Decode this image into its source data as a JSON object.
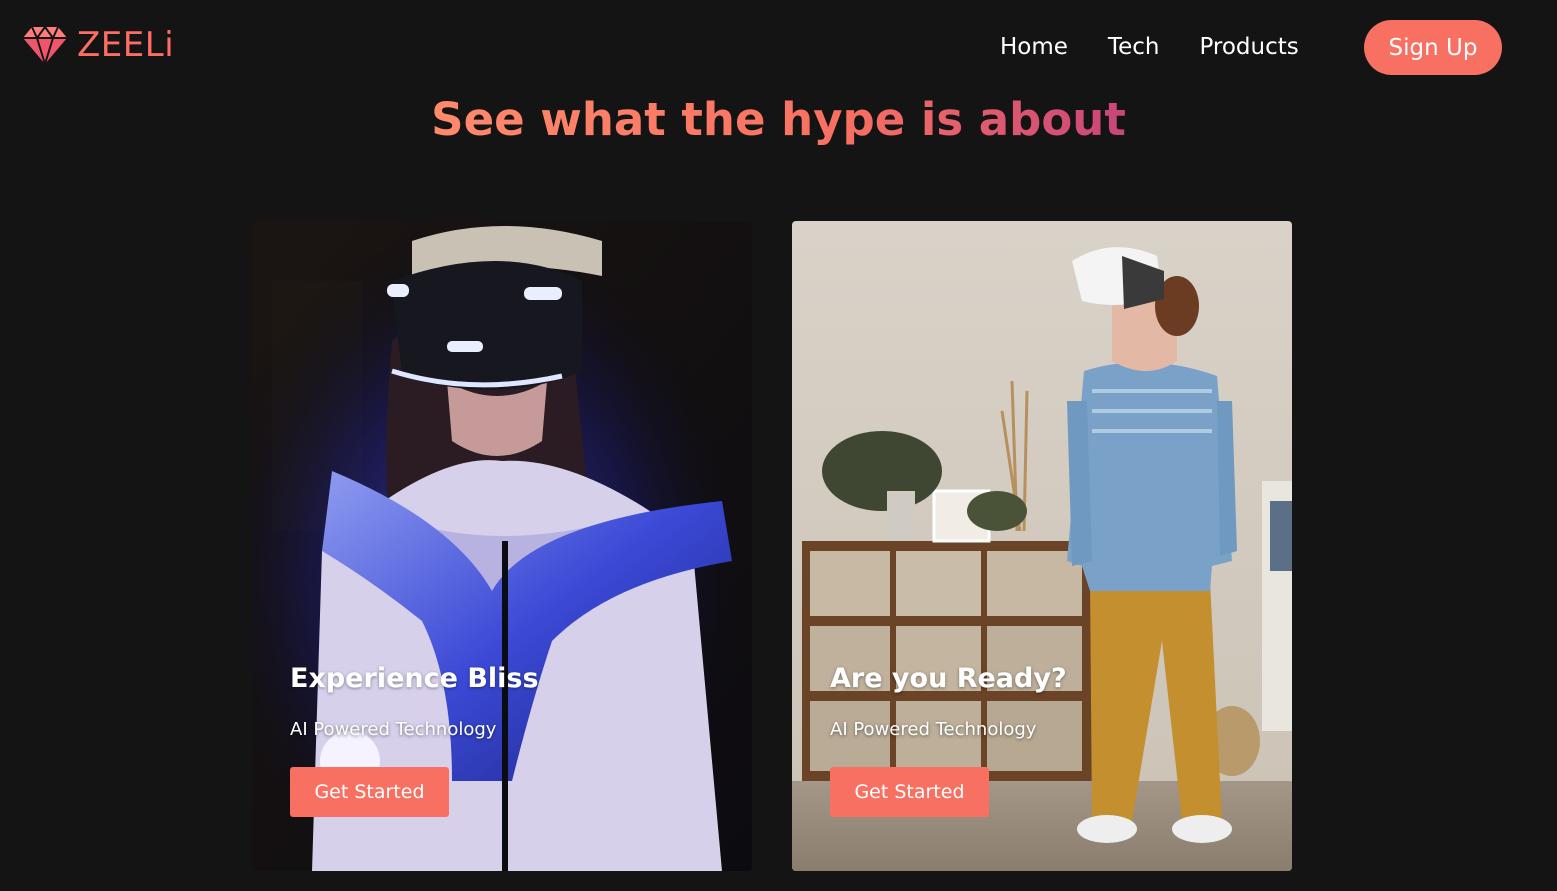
{
  "brand": {
    "name": "ZEELi",
    "logo_icon": "diamond-icon",
    "color": "#fc6d63"
  },
  "nav": {
    "links": [
      "Home",
      "Tech",
      "Products"
    ],
    "signup_label": "Sign Up"
  },
  "hero": {
    "title": "See what the hype is about"
  },
  "cards": [
    {
      "title": "Experience Bliss",
      "subtitle": "AI Powered Technology",
      "button_label": "Get Started",
      "image": "woman-vr-headset-photo"
    },
    {
      "title": "Are you Ready?",
      "subtitle": "AI Powered Technology",
      "button_label": "Get Started",
      "image": "boy-vr-headset-photo"
    }
  ],
  "colors": {
    "background": "#141414",
    "accent": "#f77062",
    "gradient_end": "#c8467a"
  }
}
